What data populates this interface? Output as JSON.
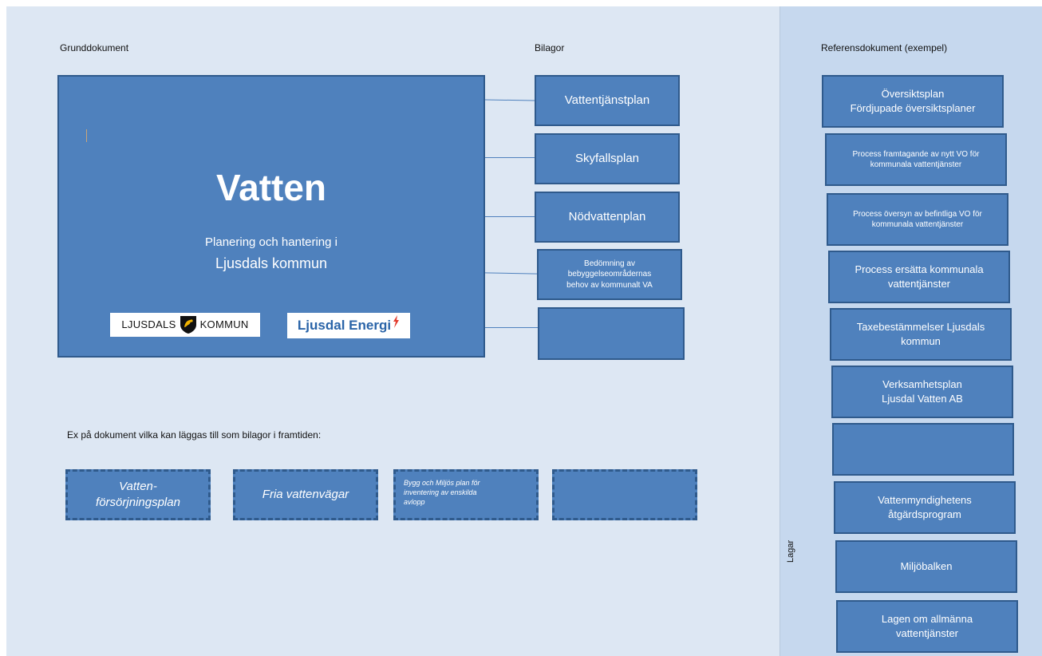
{
  "headings": {
    "grunddokument": "Grunddokument",
    "bilagor": "Bilagor",
    "referens": "Referensdokument (exempel)",
    "examples": "Ex på dokument vilka kan läggas till som bilagor i framtiden:",
    "lagar": "Lagar"
  },
  "main": {
    "title": "Vatten",
    "subtitle_line1": "Planering och hantering i",
    "subtitle_line2": "Ljusdals kommun",
    "logo_left_a": "LJUSDALS",
    "logo_left_b": "KOMMUN",
    "logo_right": "Ljusdal Energi"
  },
  "bilagor": [
    {
      "line1": "Vattentjänstplan"
    },
    {
      "line1": "Skyfallsplan"
    },
    {
      "line1": "Nödvattenplan"
    },
    {
      "line1": "Bedömning av",
      "line2": "bebyggelseområdernas",
      "line3": "behov av kommunalt VA"
    },
    {
      "line1": ""
    }
  ],
  "future": [
    {
      "line1": "Vatten-",
      "line2": "försörjningsplan"
    },
    {
      "line1": "Fria vattenvägar"
    },
    {
      "line1": "Bygg och Miljös plan för",
      "line2": "inventering av enskilda",
      "line3": "avlopp"
    },
    {
      "line1": ""
    }
  ],
  "referens": [
    {
      "line1": "Översiktsplan",
      "line2": "Fördjupade översiktsplaner"
    },
    {
      "line1": "Process framtagande av nytt VO för",
      "line2": "kommunala vattentjänster"
    },
    {
      "line1": "Process översyn av befintliga VO för",
      "line2": "kommunala vattentjänster"
    },
    {
      "line1": "Process ersätta  kommunala",
      "line2": "vattentjänster"
    },
    {
      "line1": "Taxebestämmelser Ljusdals",
      "line2": "kommun"
    },
    {
      "line1": "Verksamhetsplan",
      "line2": "Ljusdal Vatten AB"
    },
    {
      "line1": ""
    },
    {
      "line1": "Vattenmyndighetens",
      "line2": "åtgärdsprogram"
    },
    {
      "line1": "Miljöbalken"
    },
    {
      "line1": "Lagen om allmänna",
      "line2": "vattentjänster"
    }
  ],
  "colors": {
    "box_fill": "#4f81bd",
    "box_border": "#2f5a8c",
    "canvas": "#dde7f3",
    "right_panel": "#c6d8ee"
  }
}
